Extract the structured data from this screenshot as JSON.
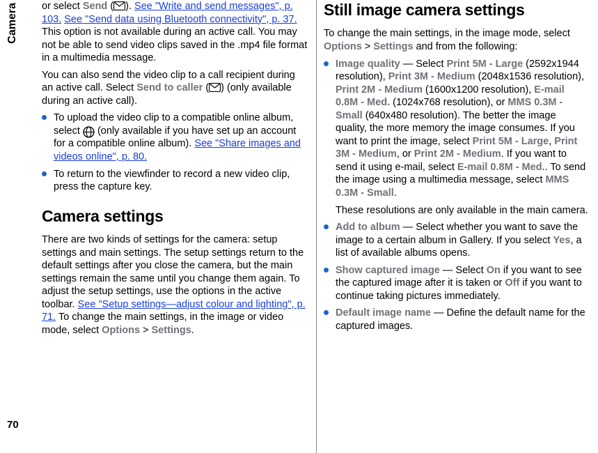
{
  "sidebar": {
    "tab": "Camera",
    "page_number": "70"
  },
  "left": {
    "p1_a": "or select ",
    "p1_send": "Send",
    "p1_b": " (",
    "p1_c": "). ",
    "p1_link1": "See \"Write and send messages\", p. 103.",
    "p1_d": " ",
    "p1_link2": "See \"Send data using Bluetooth connectivity\", p. 37.",
    "p1_e": " This option is not available during an active call. You may not be able to send video clips saved in the .mp4 file format in a multimedia message.",
    "p2_a": "You can also send the video clip to a call recipient during an active call. Select ",
    "p2_sendcaller": "Send to caller",
    "p2_b": " (",
    "p2_c": ") (only available during an active call).",
    "bullet1_a": "To upload the video clip to a compatible online album, select ",
    "bullet1_b": " (only available if you have set up an account for a compatible online album). ",
    "bullet1_link": "See \"Share images and videos online\", p. 80.",
    "bullet2": "To return to the viewfinder to record a new video clip, press the capture key.",
    "h1": "Camera settings",
    "p3_a": "There are two kinds of settings for the camera: setup settings and main settings. The setup settings return to the default settings after you close the camera, but the main settings remain the same until you change them again. To adjust the setup settings, use the options in the active toolbar. ",
    "p3_link": "See \"Setup settings—adjust colour and lighting\", p. 71.",
    "p3_b": " To change the main settings, in the image or video mode, select ",
    "p3_options": "Options",
    "p3_gt": " > ",
    "p3_settings": "Settings",
    "p3_end": "."
  },
  "right": {
    "h1": "Still image camera settings",
    "intro_a": "To change the main settings, in the image mode, select ",
    "intro_options": "Options",
    "intro_gt": " > ",
    "intro_settings": "Settings",
    "intro_b": " and from the following:",
    "b1_label": "Image quality",
    "b1_dash": "  —  Select ",
    "b1_opt1": "Print 5M - Large",
    "b1_opt1res": " (2592x1944 resolution), ",
    "b1_opt2": "Print 3M - Medium",
    "b1_opt2res": " (2048x1536 resolution), ",
    "b1_opt3": "Print 2M - Medium",
    "b1_opt3res": " (1600x1200 resolution), ",
    "b1_opt4": "E-mail 0.8M - Med.",
    "b1_opt4res": " (1024x768 resolution), or ",
    "b1_opt5": "MMS 0.3M - Small",
    "b1_opt5res": " (640x480 resolution). The better the image quality, the more memory the image consumes. If you want to print the image, select ",
    "b1_opt1b": "Print 5M - Large",
    "b1_comma1": ", ",
    "b1_opt2b": "Print 3M - Medium",
    "b1_comma2": ", or ",
    "b1_opt3b": "Print 2M - Medium",
    "b1_mid": ". If you want to send it using e-mail, select ",
    "b1_opt4b": "E-mail 0.8M - Med.",
    "b1_mid2": ". To send the image using a multimedia message, select ",
    "b1_opt5b": "MMS 0.3M - Small",
    "b1_end": ".",
    "b1_note": "These resolutions are only available in the main camera.",
    "b2_label": "Add to album",
    "b2_a": "  —  Select whether you want to save the image to a certain album in Gallery. If you select ",
    "b2_yes": "Yes",
    "b2_b": ", a list of available albums opens.",
    "b3_label": "Show captured image",
    "b3_a": "  —  Select ",
    "b3_on": "On",
    "b3_b": " if you want to see the captured image after it is taken or ",
    "b3_off": "Off",
    "b3_c": " if you want to continue taking pictures immediately.",
    "b4_label": "Default image name",
    "b4_a": "  —  Define the default name for the captured images."
  }
}
